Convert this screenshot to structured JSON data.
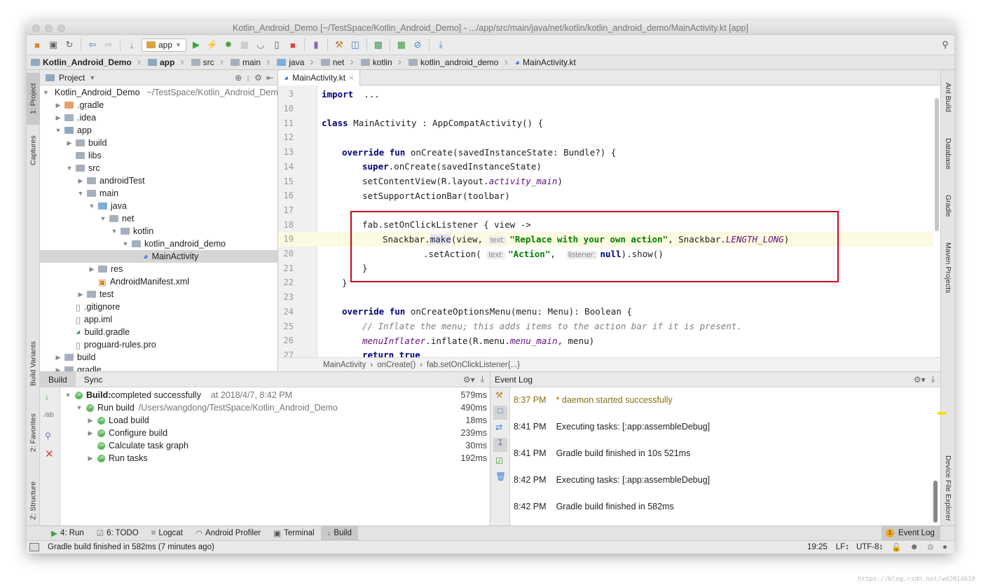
{
  "window": {
    "title": "Kotlin_Android_Demo [~/TestSpace/Kotlin_Android_Demo] - .../app/src/main/java/net/kotlin/kotlin_android_demo/MainActivity.kt [app]"
  },
  "toolbar": {
    "run_config": "app"
  },
  "breadcrumb": [
    "Kotlin_Android_Demo",
    "app",
    "src",
    "main",
    "java",
    "net",
    "kotlin",
    "kotlin_android_demo",
    "MainActivity.kt"
  ],
  "left_strip": {
    "project": "1: Project",
    "captures": "Captures",
    "build_variants": "Build Variants",
    "favorites": "2: Favorites",
    "structure": "Z: Structure"
  },
  "right_strip": {
    "ant": "Ant Build",
    "database": "Database",
    "gradle": "Gradle",
    "maven": "Maven Projects",
    "device": "Device File Explorer"
  },
  "project": {
    "title": "Project",
    "tree": [
      {
        "level": 0,
        "arrow": "down",
        "icon": "module",
        "label": "Kotlin_Android_Demo",
        "extra": "~/TestSpace/Kotlin_Android_Demo",
        "bold": false
      },
      {
        "level": 1,
        "arrow": "right",
        "icon": "orange",
        "label": ".gradle"
      },
      {
        "level": 1,
        "arrow": "right",
        "icon": "folder",
        "label": ".idea"
      },
      {
        "level": 1,
        "arrow": "down",
        "icon": "module",
        "label": "app"
      },
      {
        "level": 2,
        "arrow": "right",
        "icon": "folder",
        "label": "build"
      },
      {
        "level": 2,
        "arrow": "",
        "icon": "folder",
        "label": "libs"
      },
      {
        "level": 2,
        "arrow": "down",
        "icon": "folder",
        "label": "src"
      },
      {
        "level": 3,
        "arrow": "right",
        "icon": "folder",
        "label": "androidTest"
      },
      {
        "level": 3,
        "arrow": "down",
        "icon": "folder",
        "label": "main"
      },
      {
        "level": 4,
        "arrow": "down",
        "icon": "blue",
        "label": "java"
      },
      {
        "level": 5,
        "arrow": "down",
        "icon": "folder",
        "label": "net"
      },
      {
        "level": 6,
        "arrow": "down",
        "icon": "folder",
        "label": "kotlin"
      },
      {
        "level": 7,
        "arrow": "down",
        "icon": "folder",
        "label": "kotlin_android_demo"
      },
      {
        "level": 8,
        "arrow": "",
        "icon": "kotlin",
        "label": "MainActivity",
        "selected": true
      },
      {
        "level": 4,
        "arrow": "right",
        "icon": "folder",
        "label": "res"
      },
      {
        "level": 4,
        "arrow": "",
        "icon": "xml",
        "label": "AndroidManifest.xml"
      },
      {
        "level": 3,
        "arrow": "right",
        "icon": "folder",
        "label": "test"
      },
      {
        "level": 2,
        "arrow": "",
        "icon": "file",
        "label": ".gitignore"
      },
      {
        "level": 2,
        "arrow": "",
        "icon": "file",
        "label": "app.iml"
      },
      {
        "level": 2,
        "arrow": "",
        "icon": "gradle",
        "label": "build.gradle"
      },
      {
        "level": 2,
        "arrow": "",
        "icon": "file",
        "label": "proguard-rules.pro"
      },
      {
        "level": 1,
        "arrow": "right",
        "icon": "folder",
        "label": "build"
      },
      {
        "level": 1,
        "arrow": "right",
        "icon": "folder",
        "label": "gradle"
      }
    ]
  },
  "editor": {
    "tab": "MainActivity.kt",
    "lines": [
      {
        "n": "3",
        "ind": 0,
        "t": [
          [
            "kw",
            "import"
          ],
          [
            "",
            "  ..."
          ]
        ]
      },
      {
        "n": "10",
        "ind": 0,
        "t": []
      },
      {
        "n": "11",
        "ind": 0,
        "t": [
          [
            "kw",
            "class"
          ],
          [
            "",
            " MainActivity : AppCompatActivity() {"
          ]
        ]
      },
      {
        "n": "12",
        "ind": 0,
        "t": []
      },
      {
        "n": "13",
        "ind": 1,
        "t": [
          [
            "kw",
            "override fun"
          ],
          [
            "",
            " onCreate(savedInstanceState: Bundle?) {"
          ]
        ]
      },
      {
        "n": "14",
        "ind": 2,
        "t": [
          [
            "kw",
            "super"
          ],
          [
            "",
            ".onCreate(savedInstanceState)"
          ]
        ]
      },
      {
        "n": "15",
        "ind": 2,
        "t": [
          [
            "",
            "setContentView(R.layout."
          ],
          [
            "it",
            "activity_main"
          ],
          [
            "",
            ")"
          ]
        ]
      },
      {
        "n": "16",
        "ind": 2,
        "t": [
          [
            "",
            "setSupportActionBar(toolbar)"
          ]
        ]
      },
      {
        "n": "17",
        "ind": 0,
        "t": []
      },
      {
        "n": "18",
        "ind": 2,
        "t": [
          [
            "",
            "fab.setOnClickListener { view ->"
          ]
        ]
      },
      {
        "n": "19",
        "ind": 3,
        "cur": true,
        "t": [
          [
            "",
            "Snackbar."
          ],
          [
            "hl",
            "make"
          ],
          [
            "",
            "(view, "
          ],
          [
            "hint",
            "text:"
          ],
          [
            "str",
            "\"Replace with your own action\""
          ],
          [
            "",
            ", Snackbar."
          ],
          [
            "it",
            "LENGTH_LONG"
          ],
          [
            "",
            ")"
          ]
        ]
      },
      {
        "n": "20",
        "ind": 5,
        "t": [
          [
            "",
            ".setAction( "
          ],
          [
            "hint",
            "text:"
          ],
          [
            "str",
            "\"Action\""
          ],
          [
            "",
            ",  "
          ],
          [
            "hint",
            "listener:"
          ],
          [
            "kw",
            "null"
          ],
          [
            "",
            ").show()"
          ]
        ]
      },
      {
        "n": "21",
        "ind": 2,
        "t": [
          [
            "",
            "}"
          ]
        ]
      },
      {
        "n": "22",
        "ind": 1,
        "t": [
          [
            "",
            "}"
          ]
        ]
      },
      {
        "n": "23",
        "ind": 0,
        "t": []
      },
      {
        "n": "24",
        "ind": 1,
        "t": [
          [
            "kw",
            "override fun"
          ],
          [
            "",
            " onCreateOptionsMenu(menu: Menu): Boolean {"
          ]
        ]
      },
      {
        "n": "25",
        "ind": 2,
        "t": [
          [
            "cm",
            "// Inflate the menu; this adds items to the action bar if it is present."
          ]
        ]
      },
      {
        "n": "26",
        "ind": 2,
        "t": [
          [
            "it",
            "menuInflater"
          ],
          [
            "",
            ".inflate(R.menu."
          ],
          [
            "it",
            "menu_main"
          ],
          [
            "",
            ", menu)"
          ]
        ]
      },
      {
        "n": "27",
        "ind": 2,
        "t": [
          [
            "kw",
            "return true"
          ]
        ]
      }
    ],
    "breadcrumb": [
      "MainActivity",
      "onCreate()",
      "fab.setOnClickListener{...}"
    ]
  },
  "build": {
    "tabs": [
      "Build",
      "Sync"
    ],
    "active_tab": "Build",
    "rows": [
      {
        "level": 0,
        "arrow": "down",
        "bold": "Build:",
        "label": " completed successfully",
        "extra": "at 2018/4/7, 8:42 PM",
        "dur": "579ms"
      },
      {
        "level": 1,
        "arrow": "down",
        "label": "Run build",
        "extra": "/Users/wangdong/TestSpace/Kotlin_Android_Demo",
        "dur": "490ms"
      },
      {
        "level": 2,
        "arrow": "right",
        "label": "Load build",
        "dur": "18ms"
      },
      {
        "level": 2,
        "arrow": "right",
        "label": "Configure build",
        "dur": "239ms"
      },
      {
        "level": 2,
        "arrow": "",
        "label": "Calculate task graph",
        "dur": "30ms"
      },
      {
        "level": 2,
        "arrow": "right",
        "label": "Run tasks",
        "dur": "192ms"
      }
    ]
  },
  "event_log": {
    "title": "Event Log",
    "entries": [
      {
        "time": "8:37 PM",
        "msg": "* daemon started successfully",
        "color": "#8a6d0b"
      },
      {
        "time": "8:41 PM",
        "msg": "Executing tasks: [:app:assembleDebug]"
      },
      {
        "time": "8:41 PM",
        "msg": "Gradle build finished in 10s 521ms"
      },
      {
        "time": "8:42 PM",
        "msg": "Executing tasks: [:app:assembleDebug]"
      },
      {
        "time": "8:42 PM",
        "msg": "Gradle build finished in 582ms"
      }
    ]
  },
  "tool_windows": [
    {
      "label": "4: Run",
      "icon": "run-icon"
    },
    {
      "label": "6: TODO",
      "icon": "todo-icon"
    },
    {
      "label": "Logcat",
      "icon": "logcat-icon"
    },
    {
      "label": "Android Profiler",
      "icon": "profiler-icon"
    },
    {
      "label": "Terminal",
      "icon": "terminal-icon"
    },
    {
      "label": "Build",
      "icon": "build-icon",
      "active": true
    }
  ],
  "event_log_button": {
    "count": "1",
    "label": "Event Log"
  },
  "status": {
    "message": "Gradle build finished in 582ms (7 minutes ago)",
    "position": "19:25",
    "line_sep": "LF↕",
    "encoding": "UTF-8↕"
  },
  "watermark": "https://blog.csdn.net/wd2014610"
}
